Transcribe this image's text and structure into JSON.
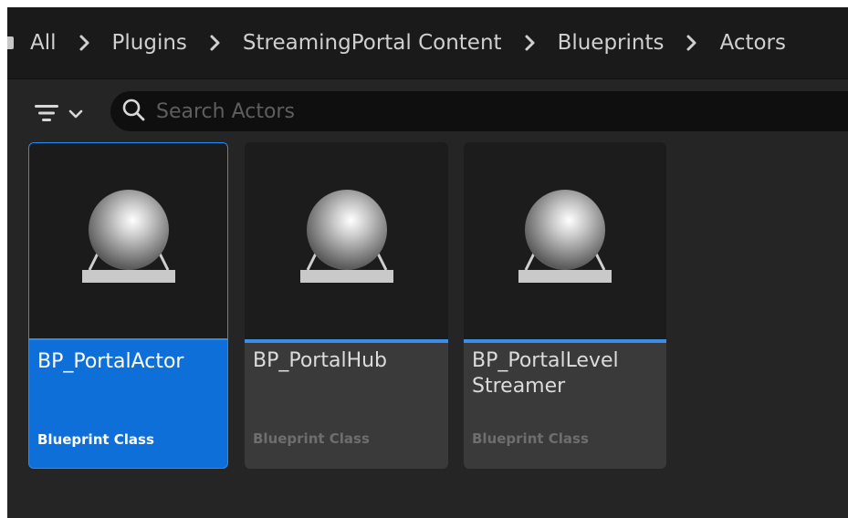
{
  "breadcrumb": {
    "items": [
      {
        "label": "All"
      },
      {
        "label": "Plugins"
      },
      {
        "label": "StreamingPortal Content"
      },
      {
        "label": "Blueprints"
      },
      {
        "label": "Actors"
      }
    ]
  },
  "toolbar": {
    "filter_icon": "filter-icon",
    "dropdown_icon": "chevron-down-icon"
  },
  "search": {
    "placeholder": "Search Actors",
    "value": ""
  },
  "assets": [
    {
      "name": "BP_PortalActor",
      "type": "Blueprint Class",
      "selected": true
    },
    {
      "name": "BP_PortalHub",
      "type": "Blueprint Class",
      "selected": false
    },
    {
      "name": "BP_PortalLevel Streamer",
      "type": "Blueprint Class",
      "selected": false
    }
  ],
  "colors": {
    "selection": "#0f6fd8",
    "accent": "#3a8ee8",
    "panel": "#252525"
  }
}
